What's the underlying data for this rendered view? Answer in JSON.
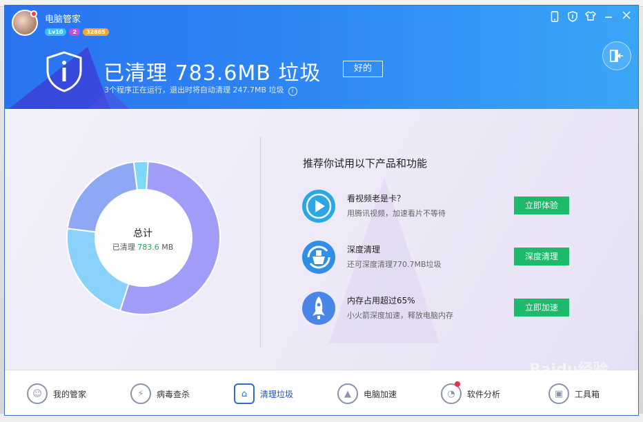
{
  "app": {
    "title": "电脑管家",
    "level_badge": "Lv10",
    "msg_badge": "2",
    "coin_badge": "32885"
  },
  "titlebar_icons": [
    "phone-icon",
    "shield-icon",
    "shirt-icon",
    "minimize-icon",
    "close-icon"
  ],
  "header": {
    "headline": "已清理 783.6MB 垃圾",
    "ok_label": "好的",
    "subline": "3个程序正在运行，退出时将自动清理 247.7MB 垃圾"
  },
  "summary": {
    "total_label": "总计",
    "cleaned_prefix": "已清理",
    "cleaned_value": "783.6",
    "cleaned_unit": "MB"
  },
  "chart_data": {
    "type": "pie",
    "shares": [
      0.54,
      0.22,
      0.21,
      0.03
    ],
    "colors": [
      "#9f9df5",
      "#8ad2fb",
      "#8fa8f3",
      "#7fd8fa"
    ]
  },
  "recommend": {
    "title": "推荐你试用以下产品和功能",
    "items": [
      {
        "title": "看视频老是卡？",
        "desc": "用腾讯视频，加速看片不等待",
        "button": "立即体验",
        "icon": "video-play-icon"
      },
      {
        "title": "深度清理",
        "desc": "还可深度清理770.7MB垃圾",
        "button": "深度清理",
        "icon": "deep-clean-icon"
      },
      {
        "title": "内存占用超过65%",
        "desc": "小火箭深度加速，释放电脑内存",
        "button": "立即加速",
        "icon": "rocket-icon"
      }
    ]
  },
  "nav": [
    {
      "label": "我的管家",
      "icon": "butler-icon",
      "active": false
    },
    {
      "label": "病毒查杀",
      "icon": "virus-scan-icon",
      "active": false
    },
    {
      "label": "清理垃圾",
      "icon": "cleanup-icon",
      "active": true
    },
    {
      "label": "电脑加速",
      "icon": "rocket-icon",
      "active": false
    },
    {
      "label": "软件分析",
      "icon": "software-analysis-icon",
      "active": false
    },
    {
      "label": "工具箱",
      "icon": "toolbox-icon",
      "active": false
    }
  ],
  "watermark": "Baidu经验"
}
